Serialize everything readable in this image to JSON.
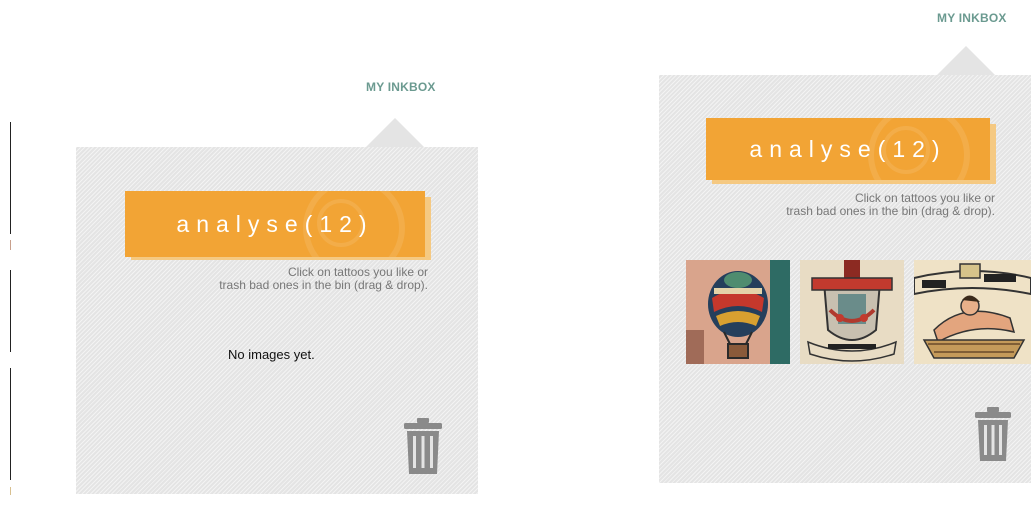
{
  "left_panel": {
    "title": "MY INKBOX",
    "banner_label": "analyse(12)",
    "instruction_line1": "Click on tattoos you like or",
    "instruction_line2": "trash bad ones in the bin (drag & drop).",
    "empty_message": "No images yet.",
    "trash_icon": "trash-bin-icon"
  },
  "right_panel": {
    "title": "MY INKBOX",
    "banner_label": "analyse(12)",
    "instruction_line1": "Click on tattoos you like or",
    "instruction_line2": "trash bad ones in the bin (drag & drop).",
    "trash_icon": "trash-bin-icon",
    "thumbnails": [
      {
        "icon": "tattoo-hot-air-balloon-thumbnail"
      },
      {
        "icon": "tattoo-sailor-crest-thumbnail"
      },
      {
        "icon": "tattoo-pinup-banner-thumbnail"
      }
    ]
  },
  "colors": {
    "accent_orange": "#f2a435",
    "title_green": "#6b9a90",
    "panel_gray": "#e4e4e4",
    "trash_gray": "#8a8a8a"
  }
}
